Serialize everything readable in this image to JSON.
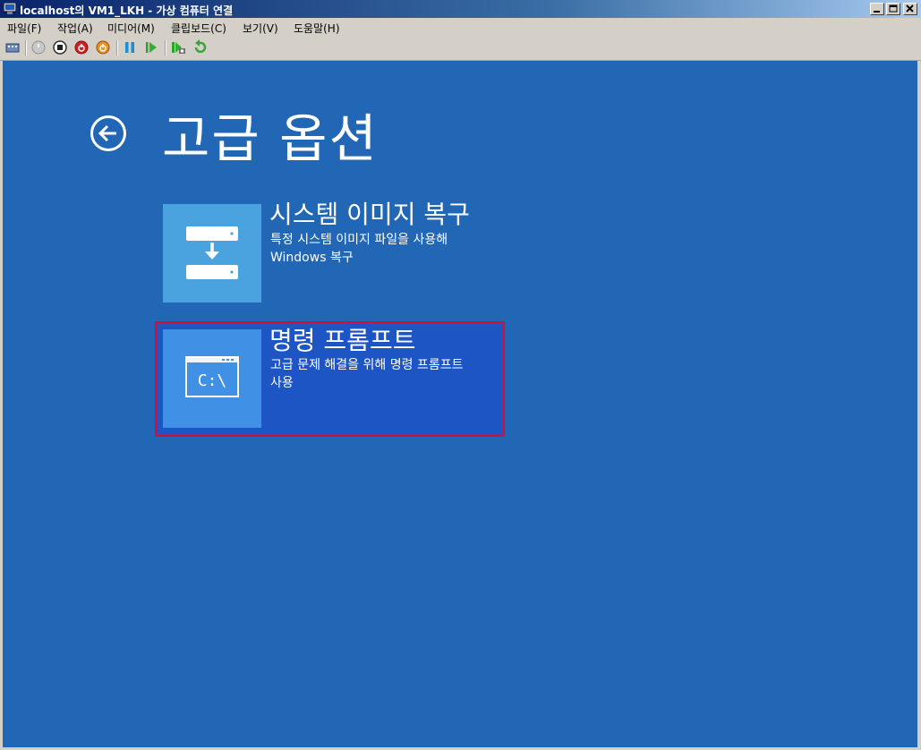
{
  "window": {
    "title": "localhost의 VM1_LKH - 가상 컴퓨터 연결",
    "icons": {
      "app": "vm-connect-icon",
      "minimize": "minimize-icon",
      "maximize": "maximize-icon",
      "close": "close-icon"
    }
  },
  "menu": {
    "items": [
      "파일(F)",
      "작업(A)",
      "미디어(M)",
      "클립보드(C)",
      "보기(V)",
      "도움말(H)"
    ]
  },
  "toolbar": {
    "buttons": [
      "ctrl-alt-del-icon",
      "start-icon",
      "turn-off-icon",
      "shut-down-icon",
      "save-icon",
      "pause-icon",
      "resume-icon",
      "snapshot-icon",
      "revert-icon"
    ]
  },
  "screen": {
    "bg_color": "#2167b6",
    "page_title": "고급 옵션",
    "options": [
      {
        "title": "시스템 이미지 복구",
        "desc_line1": "특정 시스템 이미지 파일을 사용해",
        "desc_line2": "Windows 복구",
        "icon": "system-image-recovery-icon"
      },
      {
        "title": "명령 프롬프트",
        "desc_line1": "고급 문제 해결을 위해 명령 프롬프트",
        "desc_line2": "사용",
        "icon": "command-prompt-icon",
        "icon_text": "C:\\",
        "selected": true
      }
    ]
  },
  "colors": {
    "selection_border": "#d0103a",
    "selection_fill": "#1e55c4"
  }
}
